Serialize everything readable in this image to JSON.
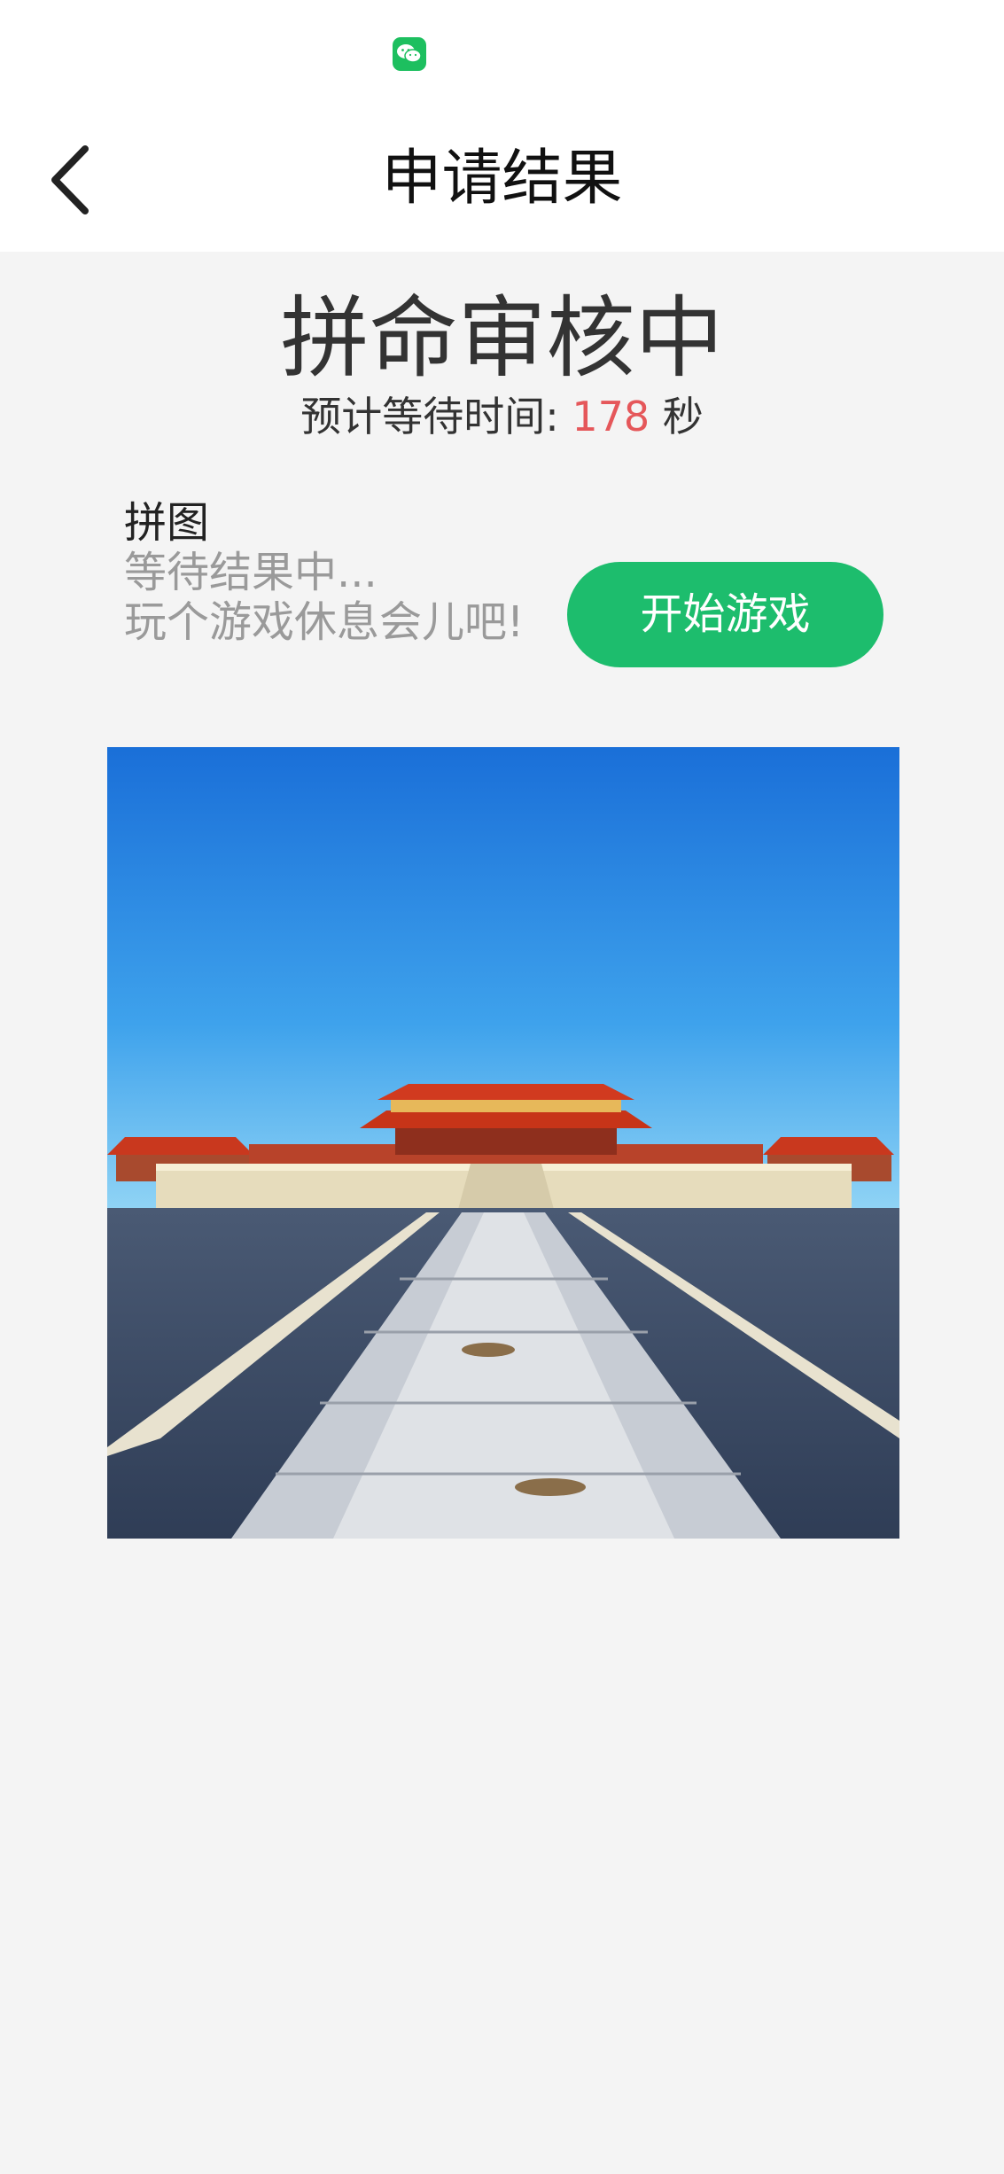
{
  "status_bar": {
    "icon": "wechat-icon"
  },
  "nav": {
    "back_icon": "chevron-left-icon",
    "title": "申请结果"
  },
  "status": {
    "title": "拼命审核中",
    "wait_prefix": "预计等待时间: ",
    "wait_seconds": "178",
    "wait_unit": " 秒"
  },
  "puzzle": {
    "label": "拼图",
    "line1": "等待结果中...",
    "line2": "玩个游戏休息会儿吧!",
    "button_label": "开始游戏",
    "image_icon": "forbidden-city-photo"
  },
  "colors": {
    "accent_green": "#1dbd6d",
    "wait_number": "#e5575a",
    "background": "#f4f4f4"
  }
}
